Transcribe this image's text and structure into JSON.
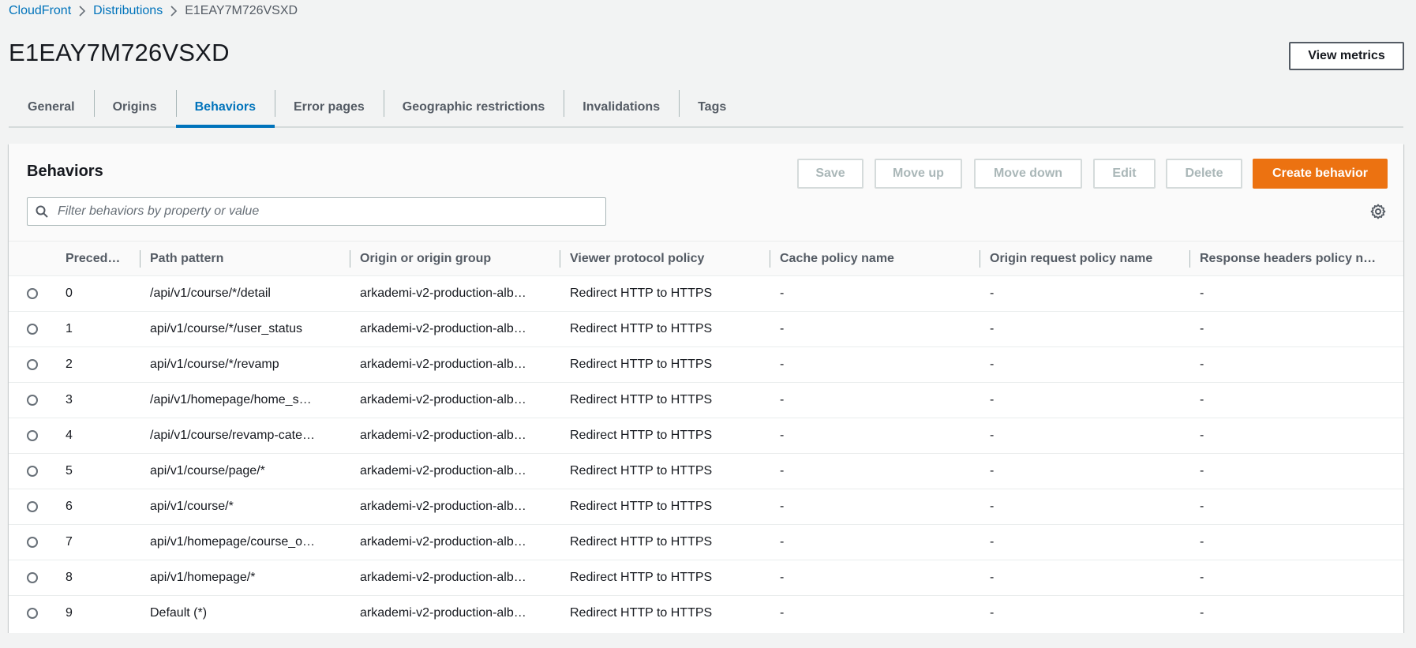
{
  "breadcrumb": [
    {
      "label": "CloudFront"
    },
    {
      "label": "Distributions"
    },
    {
      "label": "E1EAY7M726VSXD"
    }
  ],
  "page_title": "E1EAY7M726VSXD",
  "view_metrics_label": "View metrics",
  "tabs": [
    {
      "label": "General"
    },
    {
      "label": "Origins"
    },
    {
      "label": "Behaviors",
      "active": true
    },
    {
      "label": "Error pages"
    },
    {
      "label": "Geographic restrictions"
    },
    {
      "label": "Invalidations"
    },
    {
      "label": "Tags"
    }
  ],
  "panel": {
    "title": "Behaviors",
    "actions": {
      "save": "Save",
      "move_up": "Move up",
      "move_down": "Move down",
      "edit": "Edit",
      "delete": "Delete",
      "create": "Create behavior"
    },
    "filter_placeholder": "Filter behaviors by property or value"
  },
  "table": {
    "columns": [
      "Preced…",
      "Path pattern",
      "Origin or origin group",
      "Viewer protocol policy",
      "Cache policy name",
      "Origin request policy name",
      "Response headers policy n…"
    ],
    "rows": [
      [
        "0",
        "/api/v1/course/*/detail",
        "arkademi-v2-production-alb…",
        "Redirect HTTP to HTTPS",
        "-",
        "-",
        "-"
      ],
      [
        "1",
        "api/v1/course/*/user_status",
        "arkademi-v2-production-alb…",
        "Redirect HTTP to HTTPS",
        "-",
        "-",
        "-"
      ],
      [
        "2",
        "api/v1/course/*/revamp",
        "arkademi-v2-production-alb…",
        "Redirect HTTP to HTTPS",
        "-",
        "-",
        "-"
      ],
      [
        "3",
        "/api/v1/homepage/home_s…",
        "arkademi-v2-production-alb…",
        "Redirect HTTP to HTTPS",
        "-",
        "-",
        "-"
      ],
      [
        "4",
        "/api/v1/course/revamp-cate…",
        "arkademi-v2-production-alb…",
        "Redirect HTTP to HTTPS",
        "-",
        "-",
        "-"
      ],
      [
        "5",
        "api/v1/course/page/*",
        "arkademi-v2-production-alb…",
        "Redirect HTTP to HTTPS",
        "-",
        "-",
        "-"
      ],
      [
        "6",
        "api/v1/course/*",
        "arkademi-v2-production-alb…",
        "Redirect HTTP to HTTPS",
        "-",
        "-",
        "-"
      ],
      [
        "7",
        "api/v1/homepage/course_o…",
        "arkademi-v2-production-alb…",
        "Redirect HTTP to HTTPS",
        "-",
        "-",
        "-"
      ],
      [
        "8",
        "api/v1/homepage/*",
        "arkademi-v2-production-alb…",
        "Redirect HTTP to HTTPS",
        "-",
        "-",
        "-"
      ],
      [
        "9",
        "Default (*)",
        "arkademi-v2-production-alb…",
        "Redirect HTTP to HTTPS",
        "-",
        "-",
        "-"
      ]
    ]
  },
  "colors": {
    "link": "#0073bb",
    "primary": "#ec7211",
    "background": "#f2f3f3"
  }
}
